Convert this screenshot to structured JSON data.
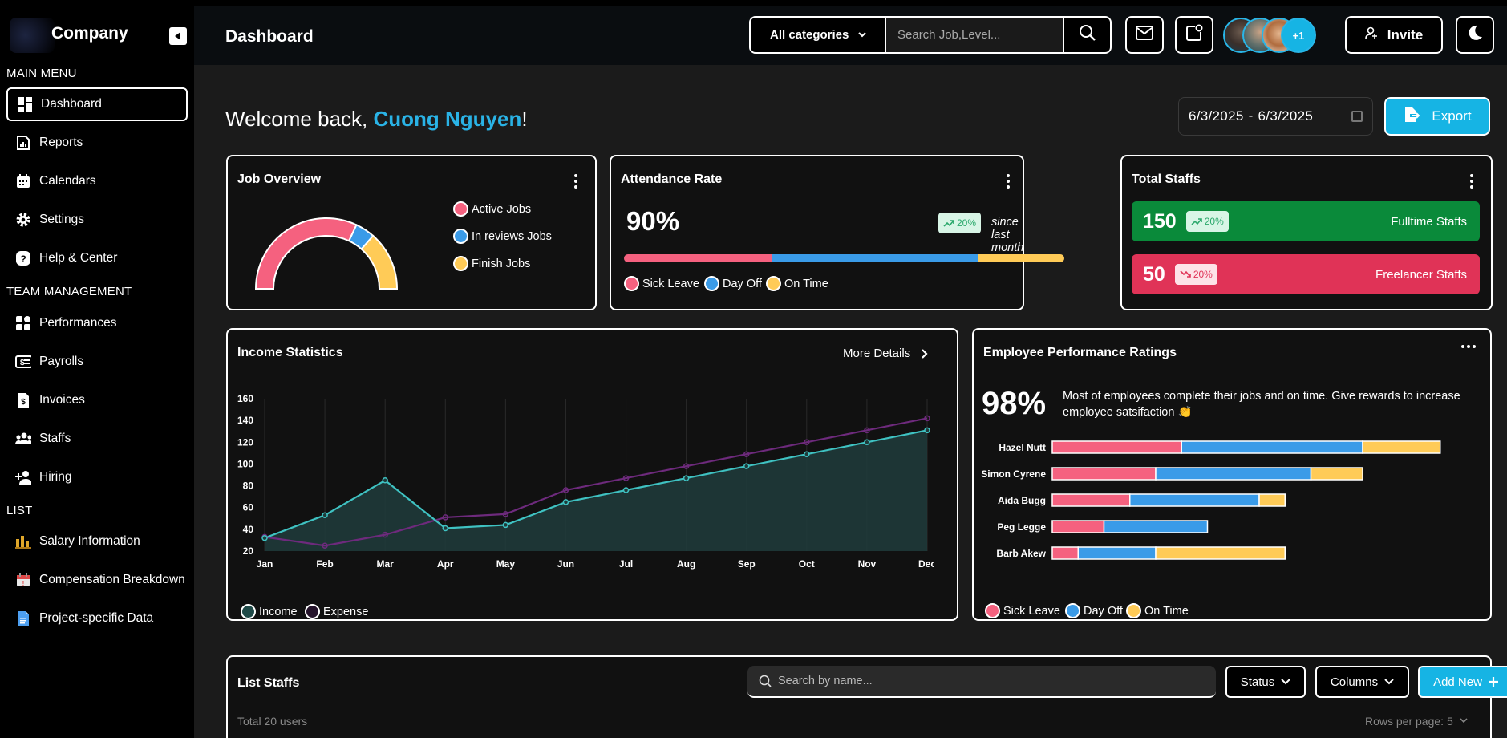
{
  "brand": {
    "name": "Company"
  },
  "sidebar": {
    "sections": [
      {
        "label": "MAIN MENU"
      },
      {
        "label": "TEAM MANAGEMENT"
      },
      {
        "label": "LIST"
      }
    ],
    "items": [
      {
        "label": "Dashboard",
        "icon": "dashboard-icon"
      },
      {
        "label": "Reports",
        "icon": "report-icon"
      },
      {
        "label": "Calendars",
        "icon": "calendar-icon"
      },
      {
        "label": "Settings",
        "icon": "gear-icon"
      },
      {
        "label": "Help & Center",
        "icon": "help-icon"
      },
      {
        "label": "Performances",
        "icon": "grid-icon"
      },
      {
        "label": "Payrolls",
        "icon": "payroll-icon"
      },
      {
        "label": "Invoices",
        "icon": "invoice-icon"
      },
      {
        "label": "Staffs",
        "icon": "people-icon"
      },
      {
        "label": "Hiring",
        "icon": "add-person-icon"
      },
      {
        "label": "Salary Information",
        "icon": "bar-chart-icon"
      },
      {
        "label": "Compensation Breakdown",
        "icon": "calendar-alert-icon"
      },
      {
        "label": "Project-specific Data",
        "icon": "document-icon"
      }
    ]
  },
  "header": {
    "title": "Dashboard",
    "category": "All categories",
    "search_placeholder": "Search Job,Level...",
    "avatars_more": "+1",
    "invite_label": "Invite"
  },
  "welcome": {
    "prefix": "Welcome back, ",
    "name": "Cuong Nguyen",
    "suffix": "!"
  },
  "date_range": {
    "start": "6/3/2025",
    "sep": "-",
    "end": "6/3/2025"
  },
  "export_label": "Export",
  "job_overview": {
    "title": "Job Overview",
    "legend": [
      "Active Jobs",
      "In reviews Jobs",
      "Finish Jobs"
    ],
    "shares": [
      0.64,
      0.09,
      0.27
    ],
    "colors": [
      "#f5617f",
      "#3a9be8",
      "#ffcb57"
    ]
  },
  "attendance": {
    "title": "Attendance Rate",
    "rate": "90%",
    "change": "20%",
    "since": "since last month",
    "shares": [
      0.335,
      0.47,
      0.195
    ],
    "legend": [
      "Sick Leave",
      "Day Off",
      "On Time"
    ]
  },
  "total_staffs": {
    "title": "Total Staffs",
    "fulltime": {
      "count": "150",
      "change": "20%",
      "label": "Fulltime Staffs"
    },
    "freelancer": {
      "count": "50",
      "change": "20%",
      "label": "Freelancer Staffs"
    }
  },
  "colors": {
    "accent": "#16b4e4",
    "pink": "#f5617f",
    "blue": "#3a9be8",
    "yellow": "#ffcb57",
    "green": "#0a8a3a",
    "red": "#e03357",
    "teal": "#3fc2c2",
    "purple": "#6e2a7d"
  },
  "income": {
    "title": "Income Statistics",
    "more": "More Details",
    "legend": [
      "Income",
      "Expense"
    ]
  },
  "performance": {
    "title": "Employee Performance Ratings",
    "rate": "98%",
    "text": "Most of employees complete their jobs and on time. Give rewards to increase employee satsifaction 👏",
    "legend": [
      "Sick Leave",
      "Day Off",
      "On Time"
    ]
  },
  "list_staffs": {
    "title": "List Staffs",
    "search_placeholder": "Search by name...",
    "status_label": "Status",
    "columns_label": "Columns",
    "add_label": "Add New",
    "total": "Total 20 users",
    "rows_per_page": "Rows per page: 5"
  },
  "chart_data": [
    {
      "type": "line",
      "title": "Income Statistics",
      "categories": [
        "Jan",
        "Feb",
        "Mar",
        "Apr",
        "May",
        "Jun",
        "Jul",
        "Aug",
        "Sep",
        "Oct",
        "Nov",
        "Dec"
      ],
      "ylim": [
        20,
        160
      ],
      "yticks": [
        20,
        40,
        60,
        80,
        100,
        120,
        140,
        160
      ],
      "series": [
        {
          "name": "Income",
          "values": [
            32,
            53,
            85,
            41,
            44,
            65,
            76,
            87,
            98,
            109,
            120,
            131
          ]
        },
        {
          "name": "Expense",
          "values": [
            33,
            25,
            35,
            51,
            54,
            76,
            87,
            98,
            109,
            120,
            131,
            142
          ]
        }
      ]
    },
    {
      "type": "bar",
      "title": "Employee Performance Ratings",
      "orientation": "horizontal",
      "stacked": true,
      "categories": [
        "Hazel Nutt",
        "Simon Cyrene",
        "Aida Bugg",
        "Peg Legge",
        "Barb Akew"
      ],
      "xlim": [
        0,
        160
      ],
      "xticks": [
        0,
        20,
        40,
        60,
        80,
        100,
        120,
        140,
        160
      ],
      "series": [
        {
          "name": "Sick Leave",
          "values": [
            50,
            40,
            30,
            20,
            10
          ]
        },
        {
          "name": "Day Off",
          "values": [
            70,
            60,
            50,
            40,
            30
          ]
        },
        {
          "name": "On Time",
          "values": [
            30,
            20,
            10,
            0,
            50
          ]
        }
      ]
    }
  ]
}
